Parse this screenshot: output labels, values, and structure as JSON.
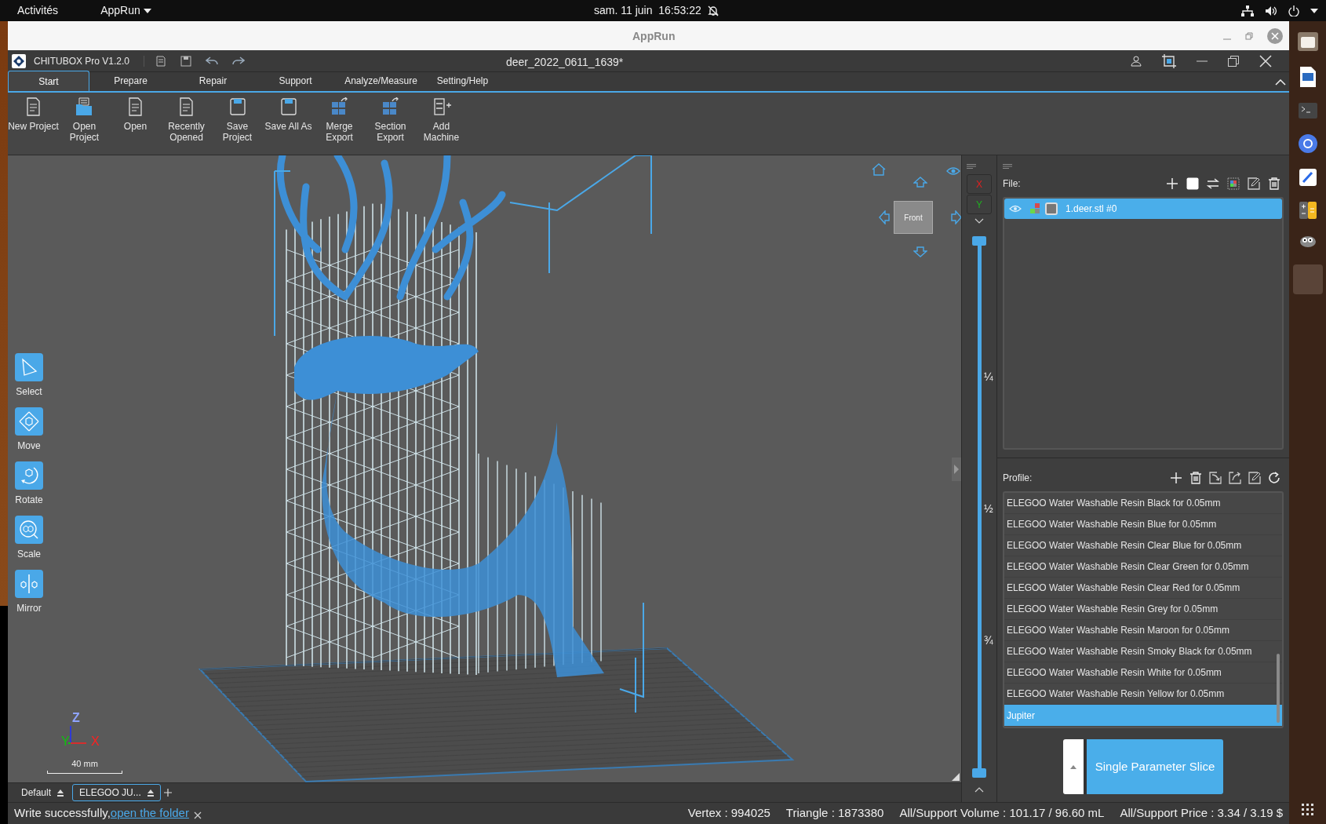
{
  "top_bar": {
    "activities": "Activités",
    "app_menu": "AppRun",
    "clock": "sam. 11 juin  16:53:22"
  },
  "outer_window": {
    "title": "AppRun"
  },
  "app_title_bar": {
    "app_name": "CHITUBOX Pro V1.2.0",
    "document": "deer_2022_0611_1639*"
  },
  "tabs": [
    {
      "label": "Start",
      "selected": true
    },
    {
      "label": "Prepare",
      "selected": false
    },
    {
      "label": "Repair",
      "selected": false
    },
    {
      "label": "Support",
      "selected": false
    },
    {
      "label": "Analyze/Measure",
      "selected": false
    },
    {
      "label": "Setting/Help",
      "selected": false
    }
  ],
  "ribbon": [
    {
      "label": "New Project",
      "kind": "document"
    },
    {
      "label": "Open Project",
      "kind": "folder"
    },
    {
      "label": "Open",
      "kind": "document"
    },
    {
      "label": "Recently Opened",
      "kind": "document"
    },
    {
      "label": "Save Project",
      "kind": "save"
    },
    {
      "label": "Save All As",
      "kind": "save"
    },
    {
      "label": "Merge Export",
      "kind": "export"
    },
    {
      "label": "Section Export",
      "kind": "export"
    },
    {
      "label": "Add Machine",
      "kind": "machine"
    }
  ],
  "tools": [
    {
      "label": "Select",
      "kind": "select"
    },
    {
      "label": "Move",
      "kind": "move"
    },
    {
      "label": "Rotate",
      "kind": "rotate"
    },
    {
      "label": "Scale",
      "kind": "scale"
    },
    {
      "label": "Mirror",
      "kind": "mirror"
    }
  ],
  "view_cube": {
    "face": "Front"
  },
  "axis_gizmo": {
    "z": "Z",
    "y": "Y",
    "x": "X"
  },
  "scale_bar": "40 mm",
  "axis_buttons": [
    "X",
    "Y"
  ],
  "layer_slider": {
    "level": 1,
    "marks": [
      "¼",
      "½",
      "¾"
    ]
  },
  "file_panel": {
    "label": "File:",
    "items": [
      {
        "name": "1.deer.stl #0",
        "selected": true
      }
    ]
  },
  "profile_panel": {
    "label": "Profile:",
    "items": [
      {
        "name": "ELEGOO Water Washable Resin Black for 0.05mm",
        "selected": false
      },
      {
        "name": "ELEGOO Water Washable Resin Blue for 0.05mm",
        "selected": false
      },
      {
        "name": "ELEGOO Water Washable Resin Clear Blue for 0.05mm",
        "selected": false
      },
      {
        "name": "ELEGOO Water Washable Resin Clear Green for 0.05mm",
        "selected": false
      },
      {
        "name": "ELEGOO Water Washable Resin Clear Red for 0.05mm",
        "selected": false
      },
      {
        "name": "ELEGOO Water Washable Resin Grey for 0.05mm",
        "selected": false
      },
      {
        "name": "ELEGOO Water Washable Resin Maroon for 0.05mm",
        "selected": false
      },
      {
        "name": "ELEGOO Water Washable Resin Smoky Black for 0.05mm",
        "selected": false
      },
      {
        "name": "ELEGOO Water Washable Resin White for 0.05mm",
        "selected": false
      },
      {
        "name": "ELEGOO Water Washable Resin Yellow for 0.05mm",
        "selected": false
      },
      {
        "name": "Jupiter",
        "selected": true
      }
    ]
  },
  "slice_button": "Single Parameter Slice",
  "bottom_tabs": [
    {
      "label": "Default",
      "selected": false
    },
    {
      "label": "ELEGOO JU...",
      "selected": true
    }
  ],
  "status": {
    "message": "Write successfully,",
    "link": "open the folder",
    "vertex": "Vertex : 994025",
    "triangle": "Triangle : 1873380",
    "volume": "All/Support Volume : 101.17 / 96.60 mL",
    "price": "All/Support Price : 3.34 / 3.19 $"
  }
}
